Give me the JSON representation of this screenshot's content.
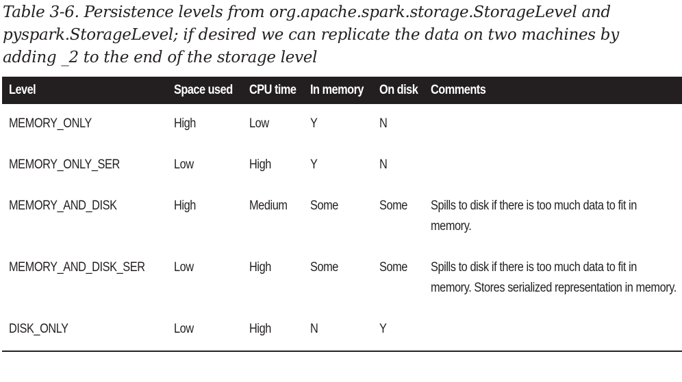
{
  "caption": "Table 3-6. Persistence levels from org.apache.spark.storage.StorageLevel and pyspark.StorageLevel; if desired we can replicate the data on two machines by adding _2 to the end of the storage level",
  "table": {
    "headers": [
      "Level",
      "Space used",
      "CPU time",
      "In memory",
      "On disk",
      "Comments"
    ],
    "rows": [
      [
        "MEMORY_ONLY",
        "High",
        "Low",
        "Y",
        "N",
        ""
      ],
      [
        "MEMORY_ONLY_SER",
        "Low",
        "High",
        "Y",
        "N",
        ""
      ],
      [
        "MEMORY_AND_DISK",
        "High",
        "Medium",
        "Some",
        "Some",
        "Spills to disk if there is too much data to fit in memory."
      ],
      [
        "MEMORY_AND_DISK_SER",
        "Low",
        "High",
        "Some",
        "Some",
        "Spills to disk if there is too much data to fit in memory. Stores serialized representation in memory."
      ],
      [
        "DISK_ONLY",
        "Low",
        "High",
        "N",
        "Y",
        ""
      ]
    ]
  },
  "colors": {
    "header_bg": "#231f20",
    "header_text": "#ffffff",
    "text": "#231f20"
  }
}
